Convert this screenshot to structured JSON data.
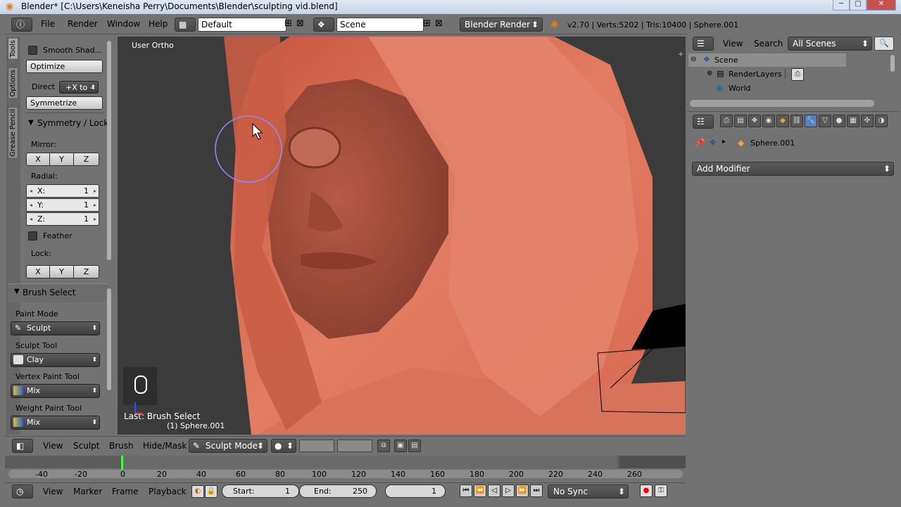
{
  "titlebar": {
    "title": "Blender* [C:\\Users\\Keneisha Perry\\Documents\\Blender\\sculpting vid.blend]",
    "min": "─",
    "max": "□",
    "close": "✕"
  },
  "info": {
    "menus": [
      "File",
      "Render",
      "Window",
      "Help"
    ],
    "layout": "Default",
    "scene": "Scene",
    "engine": "Blender Render",
    "stats": "v2.70 | Verts:5202 | Tris:10400 | Sphere.001"
  },
  "tabs": [
    "Tools",
    "Options",
    "Grease Pencil"
  ],
  "tools": {
    "smooth_shading": "Smooth Shad...",
    "optimize": "Optimize",
    "direct_label": "Direct",
    "direct_value": "+X to -",
    "symmetrize": "Symmetrize",
    "symmetry_header": "Symmetry / Lock",
    "mirror_label": "Mirror:",
    "mirror": [
      "X",
      "Y",
      "Z"
    ],
    "radial_label": "Radial:",
    "radial": [
      {
        "axis": "X:",
        "value": "1"
      },
      {
        "axis": "Y:",
        "value": "1"
      },
      {
        "axis": "Z:",
        "value": "1"
      }
    ],
    "feather": "Feather",
    "lock_label": "Lock:",
    "lock": [
      "X",
      "Y",
      "Z"
    ],
    "brush_select_header": "Brush Select",
    "paint_mode_label": "Paint Mode",
    "paint_mode": "Sculpt",
    "sculpt_tool_label": "Sculpt Tool",
    "sculpt_tool": "Clay",
    "vertex_paint_label": "Vertex Paint Tool",
    "vertex_paint": "Mix",
    "weight_paint_label": "Weight Paint Tool",
    "weight_paint": "Mix"
  },
  "viewport": {
    "view_name": "User Ortho",
    "last_op": "Last: Brush Select",
    "object_name": "(1) Sphere.001"
  },
  "view_header": {
    "menus": [
      "View",
      "Sculpt",
      "Brush",
      "Hide/Mask"
    ],
    "mode": "Sculpt Mode"
  },
  "timeline": {
    "ticks": [
      "-40",
      "-20",
      "0",
      "20",
      "40",
      "60",
      "80",
      "100",
      "120",
      "140",
      "160",
      "180",
      "200",
      "220",
      "240",
      "260"
    ],
    "menus": [
      "View",
      "Marker",
      "Frame",
      "Playback"
    ],
    "start_label": "Start:",
    "start": "1",
    "end_label": "End:",
    "end": "250",
    "current": "1",
    "sync": "No Sync"
  },
  "outliner": {
    "menus": [
      "View",
      "Search"
    ],
    "filter": "All Scenes",
    "items": [
      {
        "label": "Scene"
      },
      {
        "label": "RenderLayers"
      },
      {
        "label": "World"
      }
    ]
  },
  "properties": {
    "object": "Sphere.001",
    "add_modifier": "Add Modifier"
  },
  "colors": {
    "skin": "#d0604a",
    "viewport_bg": "#3b3b3b",
    "panel": "#727272",
    "brush_circle": "#8c8cff"
  }
}
